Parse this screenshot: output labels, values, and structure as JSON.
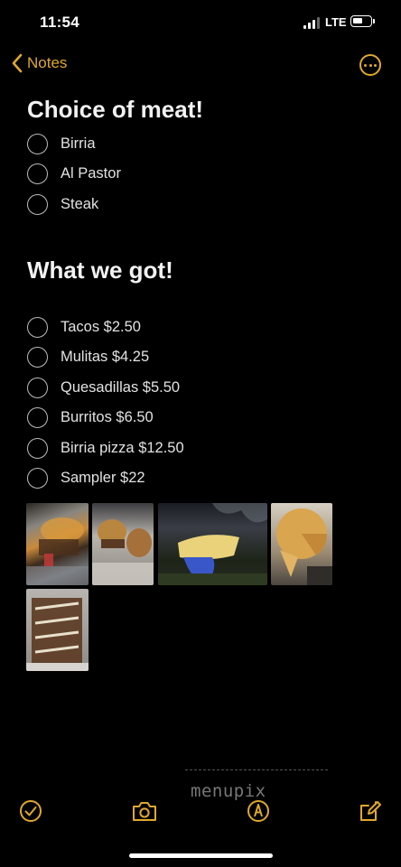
{
  "status_bar": {
    "time": "11:54",
    "network": "LTE"
  },
  "nav": {
    "back_label": "Notes"
  },
  "sections": {
    "meat": {
      "heading": "Choice of meat!",
      "items": [
        "Birria",
        "Al Pastor",
        "Steak"
      ]
    },
    "menu": {
      "heading": "What we got!",
      "items": [
        "Tacos $2.50",
        "Mulitas $4.25",
        "Quesadillas $5.50",
        "Burritos $6.50",
        "Birria pizza $12.50",
        "Sampler $22"
      ]
    }
  },
  "attachments": [
    "food-photo-1",
    "food-photo-2",
    "food-photo-3",
    "food-photo-4",
    "food-photo-5"
  ],
  "watermark": {
    "text": "menupix"
  },
  "toolbar": {
    "icons": [
      "checklist-icon",
      "camera-icon",
      "markup-icon",
      "compose-icon"
    ]
  },
  "colors": {
    "accent": "#e0a82e",
    "background": "#000000",
    "text": "#e2e2e2"
  }
}
